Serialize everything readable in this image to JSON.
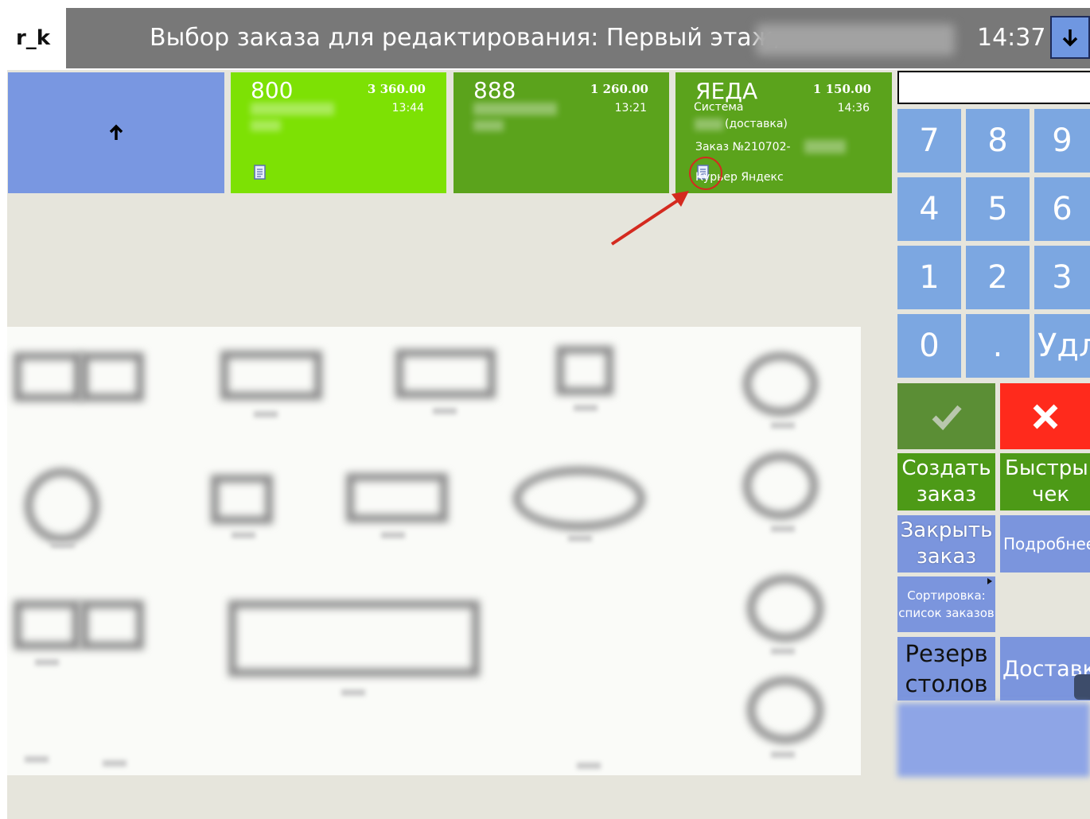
{
  "header": {
    "logo": "r_k",
    "title": "Выбор заказа для редактирования: Первый этаж,",
    "time": "14:37",
    "down_icon": "arrow-down-icon"
  },
  "orders": [
    {
      "number": "800",
      "amount": "3 360.00",
      "time": "13:44",
      "color": "#7de104"
    },
    {
      "number": "888",
      "amount": "1 260.00",
      "time": "13:21",
      "color": "#5ba31c"
    },
    {
      "number": "ЯЕДА",
      "amount": "1 150.00",
      "time": "14:36",
      "color": "#5ba31c",
      "system": "Система",
      "delivery": "(доставка)",
      "order_no": "Заказ №210702-",
      "courier": "Курьер Яндекс"
    }
  ],
  "keypad": {
    "keys": [
      "7",
      "8",
      "9",
      "4",
      "5",
      "6",
      "1",
      "2",
      "3",
      "0",
      ".",
      "Удл"
    ]
  },
  "actions": {
    "ok_icon": "checkmark-icon",
    "cancel_icon": "close-icon",
    "create_line1": "Создать",
    "create_line2": "заказ",
    "quick_line1": "Быстрый",
    "quick_line2": "чек",
    "close_line1": "Закрыть",
    "close_line2": "заказ",
    "details": "Подробнее",
    "sort_line1": "Сортировка:",
    "sort_line2": "список заказов",
    "reserve_line1": "Резерв",
    "reserve_line2": "столов",
    "delivery": "Доставка"
  },
  "colors": {
    "header_bg": "#787878",
    "order_light": "#7de104",
    "order_dark": "#5ba31c",
    "keypad": "#7ca7e1",
    "cancel_red": "#ff2a1c",
    "annotation_red": "#d42a1f"
  }
}
